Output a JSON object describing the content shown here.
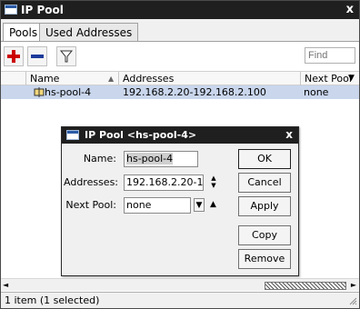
{
  "window": {
    "title": "IP Pool",
    "close_glyph": "x"
  },
  "tabs": [
    {
      "label": "Pools"
    },
    {
      "label": "Used Addresses"
    }
  ],
  "toolbar": {
    "find_placeholder": "Find"
  },
  "table": {
    "headers": [
      "Name",
      "Addresses",
      "Next Pool"
    ],
    "rows": [
      {
        "name": "hs-pool-4",
        "addresses": "192.168.2.20-192.168.2.100",
        "next_pool": "none"
      }
    ]
  },
  "status": {
    "text": "1 item (1 selected)"
  },
  "dialog": {
    "title": "IP Pool <hs-pool-4>",
    "close_glyph": "x",
    "fields": {
      "name_label": "Name:",
      "name_value": "hs-pool-4",
      "addresses_label": "Addresses:",
      "addresses_value": "192.168.2.20-192.",
      "next_pool_label": "Next Pool:",
      "next_pool_value": "none"
    },
    "buttons": {
      "ok": "OK",
      "cancel": "Cancel",
      "apply": "Apply",
      "copy": "Copy",
      "remove": "Remove"
    }
  },
  "colors": {
    "titlebar": "#1f1f1f",
    "selection": "#c9d6ec",
    "add_icon": "#cc0000",
    "remove_icon": "#1a3a9a"
  },
  "icons": [
    "add-icon",
    "remove-icon",
    "filter-icon",
    "pool-icon",
    "close-icon"
  ]
}
